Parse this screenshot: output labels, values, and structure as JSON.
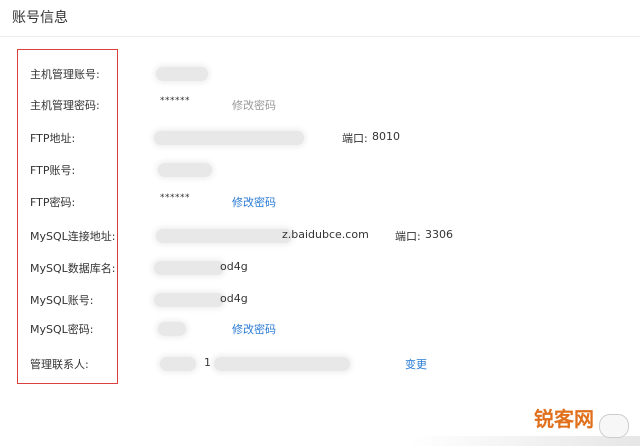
{
  "page": {
    "title": "账号信息"
  },
  "fields": {
    "host_account": {
      "label": "主机管理账号:"
    },
    "host_password": {
      "label": "主机管理密码:",
      "masked": "******",
      "action": "修改密码"
    },
    "ftp_address": {
      "label": "FTP地址:",
      "port_label": "端口:",
      "port": "8010"
    },
    "ftp_account": {
      "label": "FTP账号:"
    },
    "ftp_password": {
      "label": "FTP密码:",
      "masked": "******",
      "action": "修改密码"
    },
    "mysql_host": {
      "label": "MySQL连接地址:",
      "value_suffix": "z.baidubce.com",
      "port_label": "端口:",
      "port": "3306"
    },
    "mysql_db": {
      "label": "MySQL数据库名:",
      "value_suffix": "od4g"
    },
    "mysql_account": {
      "label": "MySQL账号:",
      "value_suffix": "od4g"
    },
    "mysql_password": {
      "label": "MySQL密码:",
      "action": "修改密码"
    },
    "admin_contact": {
      "label": "管理联系人:",
      "value_fragment": "1",
      "action": "变更"
    }
  },
  "watermark": {
    "text": "锐客网"
  },
  "colors": {
    "link": "#2a7bd4",
    "disabled_link": "#999999",
    "highlight_box": "#d94040",
    "watermark": "#e0701c"
  }
}
